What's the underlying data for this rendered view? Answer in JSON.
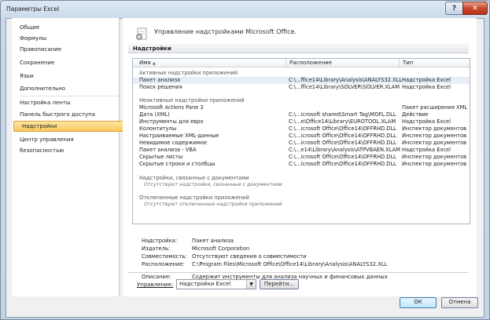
{
  "window": {
    "title": "Параметры Excel",
    "help": "?",
    "close": "✕"
  },
  "nav": {
    "items": [
      "Общие",
      "Формулы",
      "Правописание",
      "Сохранение",
      "Язык",
      "Дополнительно",
      "Настройка ленты",
      "Панель быстрого доступа",
      "Надстройки",
      "Центр управления безопасностью"
    ],
    "active_index": 8
  },
  "header": {
    "title": "Управление надстройками Microsoft Office."
  },
  "section": {
    "title": "Надстройки"
  },
  "grid": {
    "columns": [
      "Имя",
      "Расположение",
      "Тип"
    ],
    "sort_indicator": "▲",
    "groups": {
      "active": "Активные надстройки приложений",
      "inactive": "Неактивные надстройки приложений",
      "documents": "Надстройки, связанные с документами",
      "documents_note": "Отсутствуют надстройки, связанные с документами",
      "disabled": "Отключенные надстройки приложений",
      "disabled_note": "Отсутствуют отключенные надстройки приложений"
    },
    "active_rows": [
      [
        "Пакет анализа",
        "C:\\...ffice14\\Library\\Analysis\\ANALYS32.XLL",
        "Надстройка Excel"
      ],
      [
        "Поиск решения",
        "C:\\...ffice14\\Library\\SOLVER\\SOLVER.XLAM",
        "Надстройка Excel"
      ]
    ],
    "inactive_rows": [
      [
        "Microsoft Actions Pane 3",
        "",
        "Пакет расширения XML"
      ],
      [
        "Дата (XML)",
        "C:\\...icrosoft shared\\Smart Tag\\MOFL.DLL",
        "Действие"
      ],
      [
        "Инструменты для евро",
        "C:\\...e\\Office14\\Library\\EUROTOOL.XLAM",
        "Надстройка Excel"
      ],
      [
        "Колонтитулы",
        "C:\\...icrosoft Office\\Office14\\OFFRHD.DLL",
        "Инспектор документов"
      ],
      [
        "Настраиваемые XML-данные",
        "C:\\...icrosoft Office\\Office14\\OFFRHD.DLL",
        "Инспектор документов"
      ],
      [
        "Невидимое содержимое",
        "C:\\...icrosoft Office\\Office14\\OFFRHD.DLL",
        "Инспектор документов"
      ],
      [
        "Пакет анализа - VBA",
        "C:\\...e14\\Library\\Analysis\\ATPVBAEN.XLAM",
        "Надстройка Excel"
      ],
      [
        "Скрытые листы",
        "C:\\...icrosoft Office\\Office14\\OFFRHD.DLL",
        "Инспектор документов"
      ],
      [
        "Скрытые строки и столбцы",
        "C:\\...icrosoft Office\\Office14\\OFFRHD.DLL",
        "Инспектор документов"
      ]
    ]
  },
  "details": {
    "addin_label": "Надстройка:",
    "addin_value": "Пакет анализа",
    "publisher_label": "Издатель:",
    "publisher_value": "Microsoft Corporation",
    "compat_label": "Совместимость:",
    "compat_value": "Отсутствуют сведения о совместимости",
    "location_label": "Расположение:",
    "location_value": "C:\\Program Files\\Microsoft Office\\Office14\\Library\\Analysis\\ANALYS32.XLL",
    "description_label": "Описание:",
    "description_value": "Содержит инструменты для анализа научных и финансовых данных"
  },
  "manage": {
    "label": "Управление:",
    "selected": "Надстройки Excel",
    "go_button": "Перейти..."
  },
  "footer": {
    "ok": "ОК",
    "cancel": "Отмена"
  }
}
